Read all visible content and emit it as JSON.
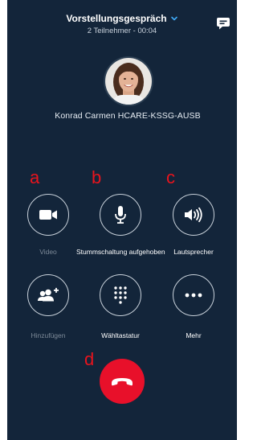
{
  "header": {
    "title": "Vorstellungsgespräch",
    "subtitle": "2 Teilnehmer - 00:04"
  },
  "caller": {
    "name": "Konrad Carmen HCARE-KSSG-AUSB"
  },
  "markers": {
    "a": "a",
    "b": "b",
    "c": "c",
    "d": "d"
  },
  "controls": {
    "video_label": "Video",
    "mute_label": "Stummschaltung aufgehoben",
    "speaker_label": "Lautsprecher",
    "add_label": "Hinzufügen",
    "dialpad_label": "Wähltastatur",
    "more_label": "Mehr"
  },
  "icons": {
    "chat": "chat-bubble-icon",
    "chevron": "chevron-down-icon",
    "video": "video-camera-icon",
    "mute": "microphone-icon",
    "speaker": "speaker-icon",
    "add": "add-people-icon",
    "dialpad": "dialpad-icon",
    "more": "more-dots-icon",
    "end_call": "end-call-icon"
  },
  "colors": {
    "background": "#13253a",
    "accent": "#3fa9f5",
    "end_call": "#e8102a",
    "marker": "#e8141d"
  }
}
